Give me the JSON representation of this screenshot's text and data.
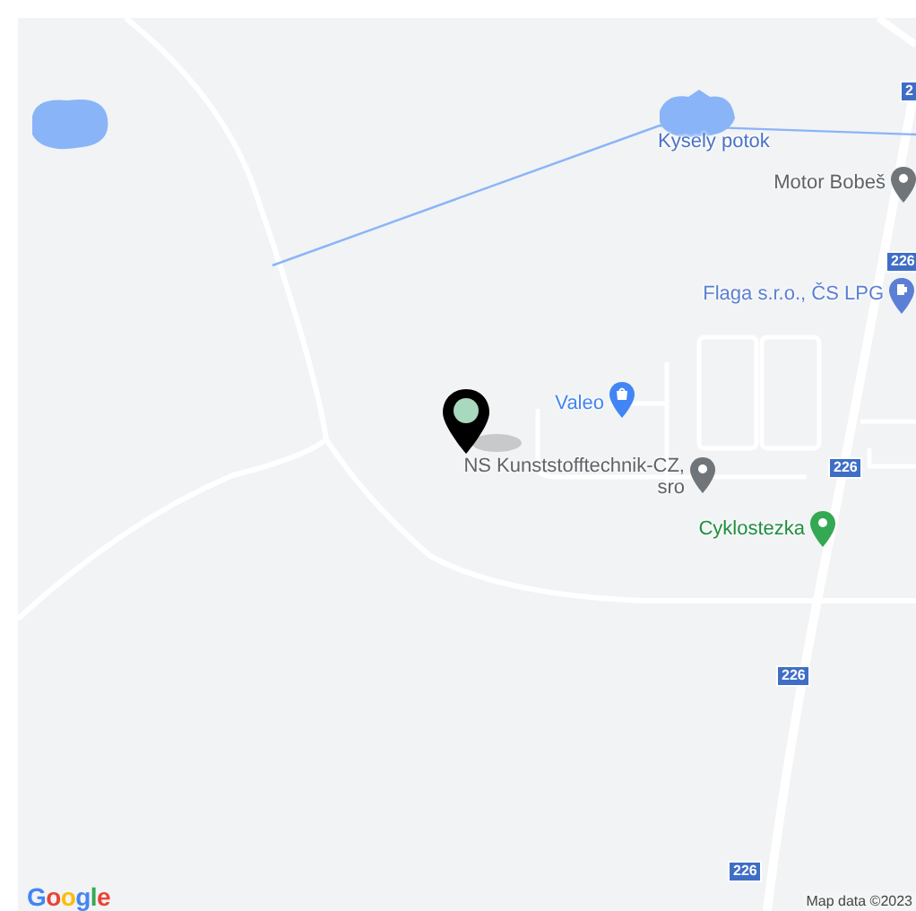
{
  "map": {
    "water_labels": [
      {
        "text": "Kysely potok"
      }
    ],
    "places": [
      {
        "name": "Motor Bobeš",
        "kind": "pin",
        "color": "#70757a"
      },
      {
        "name": "Flaga s.r.o., ČS LPG",
        "kind": "fuel",
        "color": "#5b7fd4"
      },
      {
        "name": "Valeo",
        "kind": "shop",
        "color": "#4285f4"
      },
      {
        "name": "NS Kunststofftechnik-CZ,\nsro",
        "kind": "pin",
        "color": "#70757a"
      },
      {
        "name": "Cyklostezka",
        "kind": "pin",
        "color": "#34a853"
      }
    ],
    "route_shields": [
      "2",
      "226",
      "226",
      "226",
      "226"
    ],
    "logo": "Google",
    "attribution": "Map data ©2023"
  }
}
